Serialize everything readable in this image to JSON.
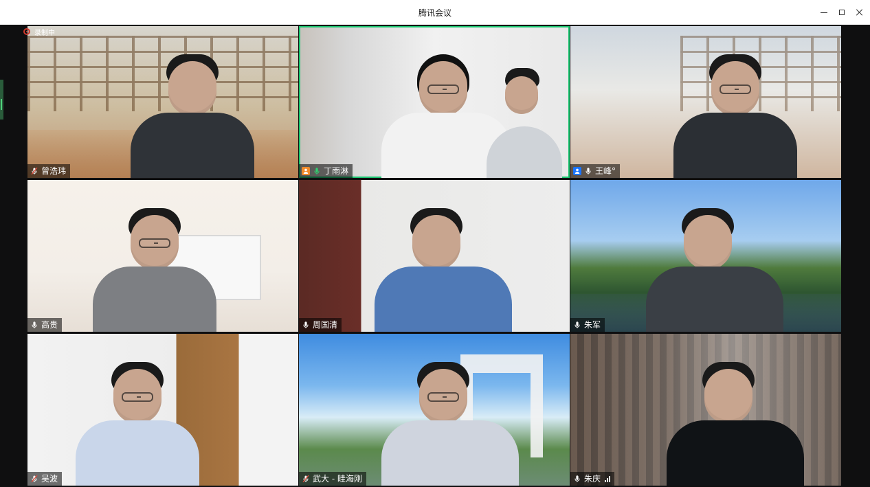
{
  "window": {
    "title": "腾讯会议"
  },
  "recording": {
    "label": "录制中"
  },
  "colors": {
    "active_speaker_border": "#19c46f",
    "name_label_bg": "rgba(0,0,0,0.55)",
    "recording_red": "#d13a2f",
    "mic_green": "#2fd06f",
    "mic_red": "#e24b3b",
    "host_orange": "#f08a2a",
    "host_blue": "#1a74ff"
  },
  "participants": [
    {
      "id": "p1",
      "name": "曾浩玮",
      "mic": "muted",
      "badge": ""
    },
    {
      "id": "p2",
      "name": "丁雨淋",
      "mic": "active",
      "badge": "host-orange"
    },
    {
      "id": "p3",
      "name": "王峰°",
      "mic": "on",
      "badge": "host-blue"
    },
    {
      "id": "p4",
      "name": "高贵",
      "mic": "on",
      "badge": ""
    },
    {
      "id": "p5",
      "name": "周国清",
      "mic": "on",
      "badge": ""
    },
    {
      "id": "p6",
      "name": "朱军",
      "mic": "on",
      "badge": ""
    },
    {
      "id": "p7",
      "name": "吴波",
      "mic": "muted",
      "badge": ""
    },
    {
      "id": "p8",
      "name": "武大 - 眭海刚",
      "mic": "muted",
      "badge": ""
    },
    {
      "id": "p9",
      "name": "朱庆",
      "mic": "on",
      "badge": ""
    }
  ]
}
